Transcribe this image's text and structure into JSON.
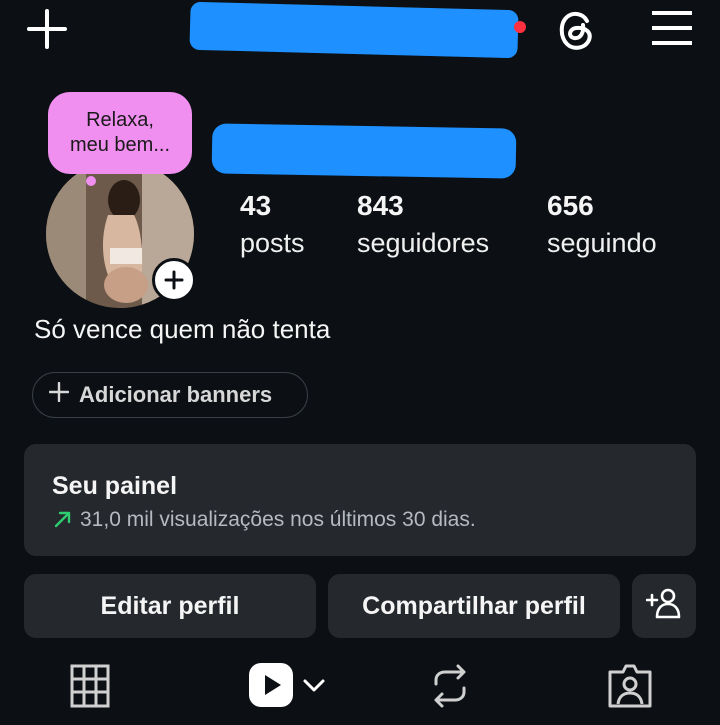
{
  "header": {
    "icons": [
      "plus-icon",
      "threads-icon",
      "menu-icon"
    ]
  },
  "note": {
    "text": "Relaxa,\nmeu bem..."
  },
  "stats": {
    "posts": {
      "value": "43",
      "label": "posts"
    },
    "followers": {
      "value": "843",
      "label": "seguidores"
    },
    "following": {
      "value": "656",
      "label": "seguindo"
    }
  },
  "bio": "Só vence quem não tenta",
  "banner_button": "Adicionar banners",
  "panel": {
    "title": "Seu painel",
    "subtitle": "31,0 mil visualizações nos últimos 30 dias.",
    "accent": "#2ecc71"
  },
  "actions": {
    "edit": "Editar perfil",
    "share": "Compartilhar perfil"
  },
  "nav": {
    "icons": [
      "grid-icon",
      "reels-icon",
      "reposts-icon",
      "tagged-icon"
    ]
  },
  "colors": {
    "background": "#0c1014",
    "card": "#25292e",
    "note": "#f08ff0",
    "redaction": "#1e90ff",
    "notification_dot": "#ff3040"
  }
}
